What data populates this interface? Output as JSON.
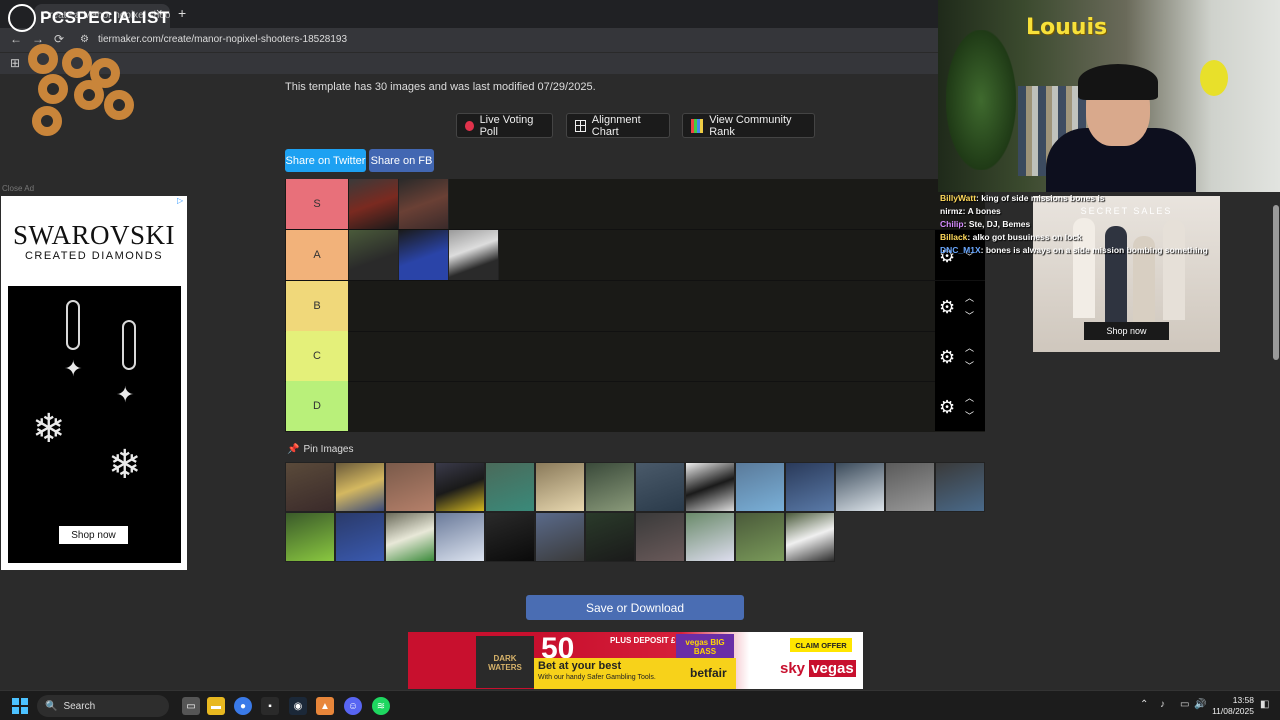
{
  "browser": {
    "tab_title": "Create a Manor nopixel shoo...",
    "tab_close": "×",
    "new_tab": "+",
    "url": "tiermaker.com/create/manor-nopixel-shooters-18528193"
  },
  "watermark": {
    "brand": "PCSPECIALIST"
  },
  "page": {
    "info": "This template has 30 images and was last modified 07/29/2025.",
    "buttons": {
      "live_voting": "Live Voting Poll",
      "alignment": "Alignment Chart",
      "community_rank": "View Community Rank"
    },
    "share": {
      "twitter": "Share on Twitter",
      "fb": "Share on FB"
    },
    "tiers": [
      {
        "label": "S",
        "color": "#e8707a",
        "count": 2
      },
      {
        "label": "A",
        "color": "#f2b27a",
        "count": 3
      },
      {
        "label": "B",
        "color": "#f0d87a",
        "count": 0
      },
      {
        "label": "C",
        "color": "#e4f07a",
        "count": 0
      },
      {
        "label": "D",
        "color": "#b9f07a",
        "count": 0
      }
    ],
    "pin_images": "Pin Images",
    "save": "Save or Download"
  },
  "left_ad": {
    "close": "Close Ad",
    "brand": "SWAROVSKI",
    "sub": "CREATED DIAMONDS",
    "cta": "Shop now"
  },
  "stream": {
    "name": "Louuis",
    "chat": [
      {
        "user": "BillyWatt",
        "msg": "king of side missions bones is",
        "color": "#ffd95a"
      },
      {
        "user": "nirmz",
        "msg": "A bones",
        "color": "#ffffff"
      },
      {
        "user": "Chilip",
        "msg": "Ste, DJ, Bemes",
        "color": "#d58bff"
      },
      {
        "user": "Billack",
        "msg": "alko got busuiness on lock",
        "color": "#ffd95a"
      },
      {
        "user": "DNC_M1X",
        "msg": "bones is always on a side mission bombing something",
        "color": "#6aa8ff"
      }
    ]
  },
  "right_ad": {
    "title": "SECRET SALES",
    "cta": "Shop now"
  },
  "bottom_ad": {
    "dark_waters": "DARK WATERS",
    "big_number": "50",
    "deposit": "PLUS DEPOSIT £ SPEND £10",
    "vegas": "vegas BIG BASS",
    "bet": "Bet at your best",
    "with": "With our handy Safer Gambling Tools.",
    "betfair": "betfair",
    "claim": "CLAIM OFFER",
    "sky_a": "sky",
    "sky_b": "vegas"
  },
  "taskbar": {
    "search": "Search",
    "time": "13:58",
    "date": "11/08/2025"
  }
}
